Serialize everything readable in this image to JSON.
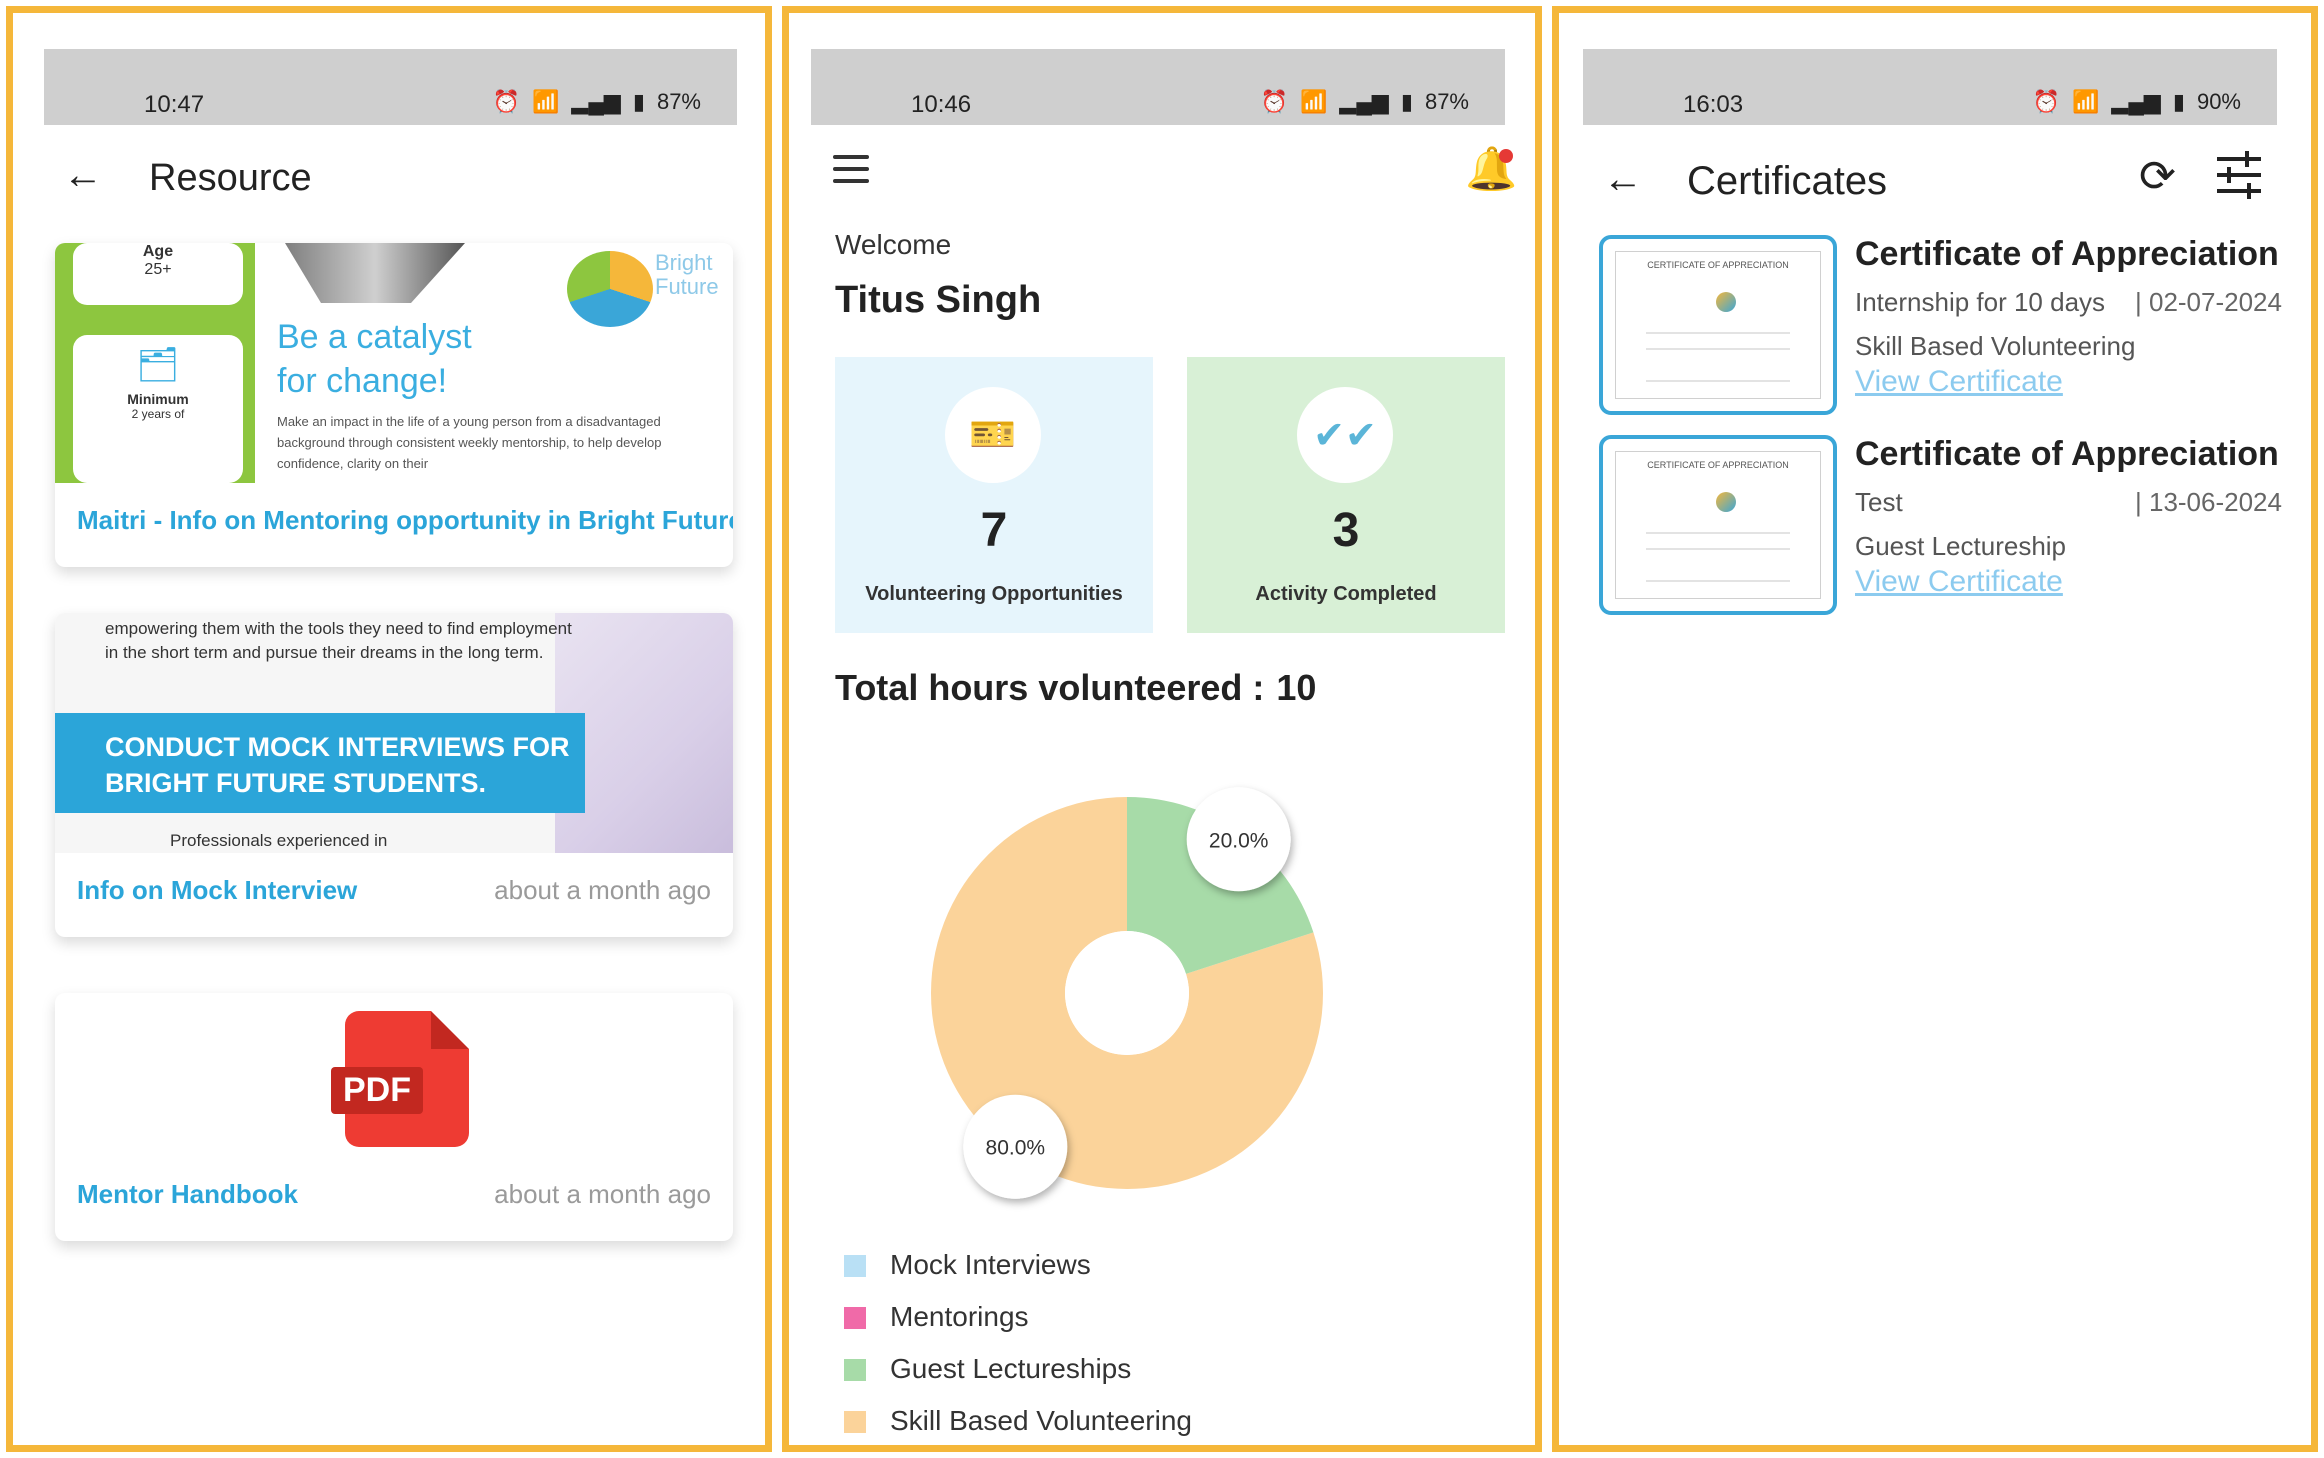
{
  "resource_screen": {
    "status": {
      "time": "10:47",
      "battery": "87%"
    },
    "title": "Resource",
    "cards": [
      {
        "image_heading_line1": "Be a catalyst",
        "image_heading_line2": "for change!",
        "image_box_age": "Age",
        "image_box_age_value": "25+",
        "image_box_min": "Minimum",
        "image_box_min_value": "2 years of",
        "image_logo_line1": "Bright",
        "image_logo_line2": "Future",
        "image_text": "Make an impact in the life of a young person from a disadvantaged background through consistent weekly mentorship, to help develop confidence, clarity on their",
        "link": "Maitri - Info on Mentoring opportunity in Bright Future",
        "time": ""
      },
      {
        "image_para": "empowering them with the tools they need to find employment in the short term and pursue their dreams in the long term.",
        "image_banner_line1": "CONDUCT MOCK INTERVIEWS  FOR",
        "image_banner_line2": "BRIGHT FUTURE STUDENTS.",
        "image_footer": "Professionals experienced in",
        "link": "Info on Mock Interview",
        "time": "about a month ago"
      },
      {
        "pdf_label": "PDF",
        "link": "Mentor Handbook",
        "time": "about a month ago"
      }
    ]
  },
  "dashboard_screen": {
    "status": {
      "time": "10:46",
      "battery": "87%"
    },
    "welcome": "Welcome",
    "username": "Titus Singh",
    "stats": [
      {
        "value": "7",
        "label": "Volunteering Opportunities",
        "icon": "ticket-icon"
      },
      {
        "value": "3",
        "label": "Activity Completed",
        "icon": "double-check-icon"
      }
    ],
    "total_hours_label": "Total hours volunteered :",
    "total_hours_value": "10",
    "legend": [
      {
        "label": "Mock Interviews",
        "color": "#b9e0f5"
      },
      {
        "label": "Mentorings",
        "color": "#f06aa8"
      },
      {
        "label": "Guest Lectureships",
        "color": "#a7dba8"
      },
      {
        "label": "Skill Based Volunteering",
        "color": "#fbd39a"
      }
    ]
  },
  "chart_data": {
    "type": "pie",
    "donut": true,
    "categories": [
      "Skill Based Volunteering",
      "Guest Lectureships"
    ],
    "values": [
      80.0,
      20.0
    ],
    "labels": [
      "80.0%",
      "20.0%"
    ],
    "colors": [
      "#fbd39a",
      "#a7dba8"
    ],
    "title": "",
    "legend_position": "bottom"
  },
  "certificates_screen": {
    "status": {
      "time": "16:03",
      "battery": "90%"
    },
    "title": "Certificates",
    "items": [
      {
        "title": "Certificate of Appreciation",
        "subtitle": "Internship for 10 days",
        "date": "| 02-07-2024",
        "type": "Skill Based Volunteering",
        "link": "View Certificate",
        "thumb_title": "CERTIFICATE OF APPRECIATION"
      },
      {
        "title": "Certificate of Appreciation",
        "subtitle": "Test",
        "date": "| 13-06-2024",
        "type": "Guest Lectureship",
        "link": "View Certificate",
        "thumb_title": "CERTIFICATE OF APPRECIATION"
      }
    ]
  }
}
